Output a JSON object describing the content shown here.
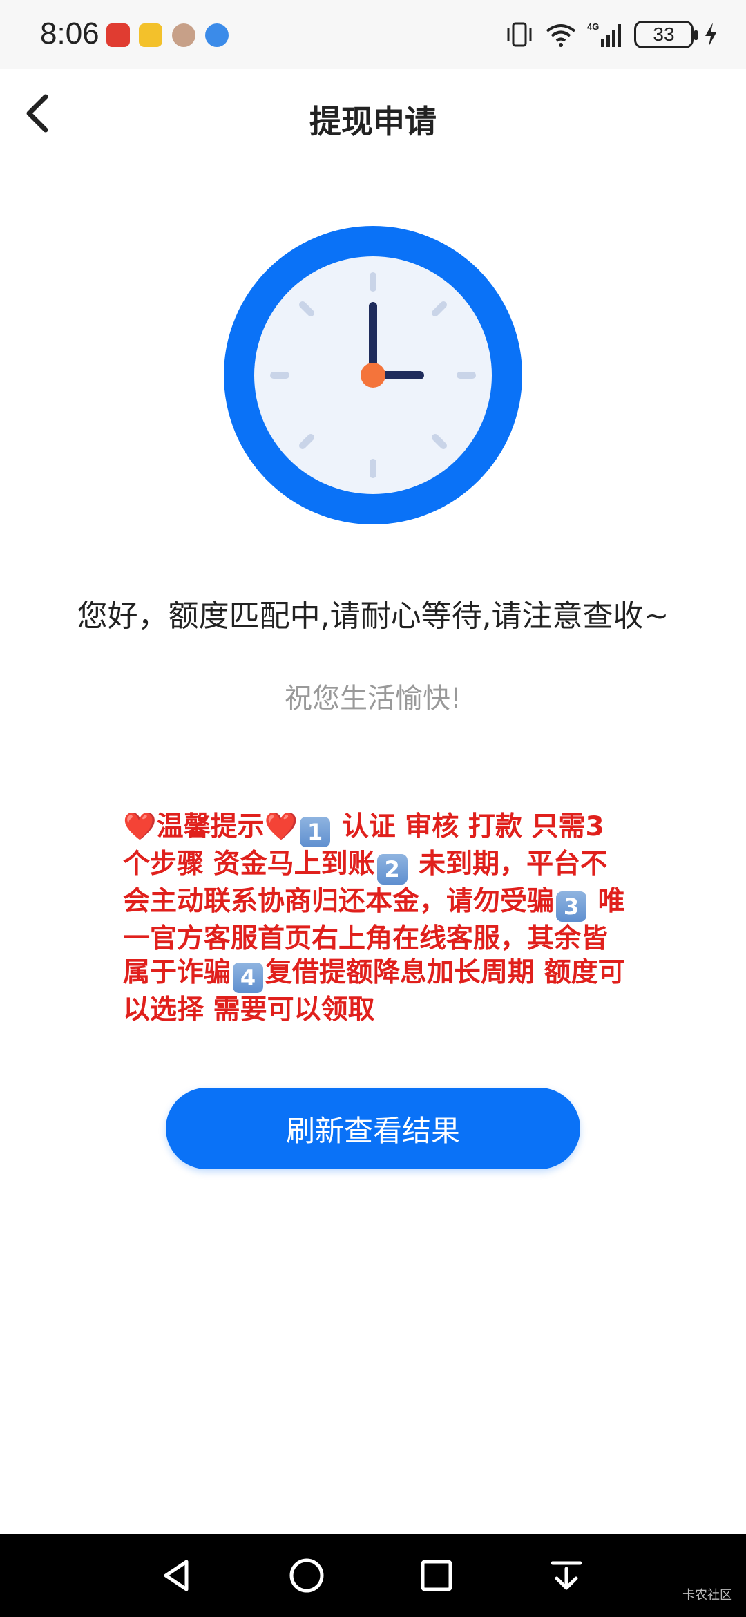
{
  "status_bar": {
    "time": "8:06",
    "battery": "33",
    "icons": [
      "huawei-app-icon",
      "app-icon",
      "avatar-app-icon",
      "browser-app-icon",
      "vibrate-icon",
      "wifi-icon",
      "4g-signal-icon",
      "charging-icon"
    ]
  },
  "header": {
    "title": "提现申请",
    "back_icon": "chevron-left-icon"
  },
  "illustration": "clock-icon",
  "message": {
    "waiting": "您好，额度匹配中,请耐心等待,请注意查收~",
    "wish": "祝您生活愉快!"
  },
  "notice": {
    "heart": "❤️",
    "title": "温馨提示",
    "step1_num": "1",
    "step1": " 认证 审核 打款 只需3个步骤  资金马上到账",
    "step2_num": "2",
    "step2": " 未到期，平台不会主动联系协商归还本金，请勿受骗",
    "step3_num": "3",
    "step3": " 唯一官方客服首页右上角在线客服，其余皆属于诈骗",
    "step4_num": "4",
    "step4": "复借提额降息加长周期 额度可以选择 需要可以领取"
  },
  "button": {
    "refresh_label": "刷新查看结果"
  },
  "colors": {
    "primary": "#0a72f7",
    "notice": "#e0201c",
    "clock_ring": "#0a72f7",
    "clock_face": "#eef3fb",
    "clock_center": "#f4743b"
  },
  "nav": [
    "back-triangle-icon",
    "home-circle-icon",
    "recents-square-icon",
    "pull-down-icon"
  ],
  "watermark": "卡农社区"
}
